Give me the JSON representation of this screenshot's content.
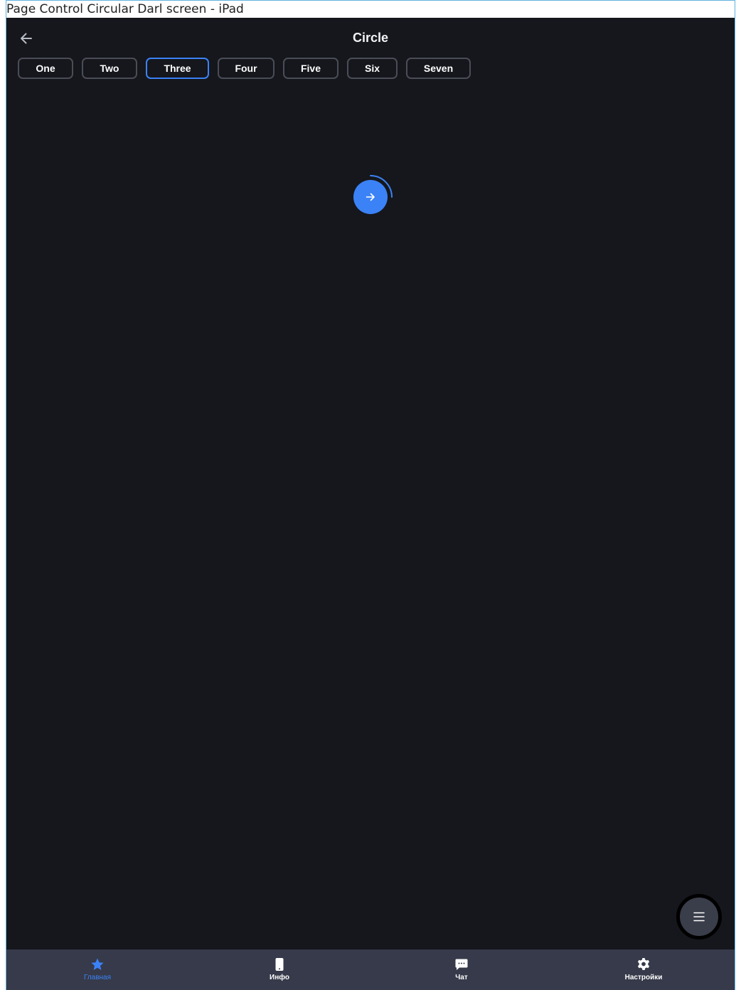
{
  "window": {
    "title": "Page Control Circular Darl screen - iPad"
  },
  "header": {
    "title": "Circle",
    "back_icon": "arrow-left-icon"
  },
  "segments": [
    {
      "label": "One",
      "selected": false
    },
    {
      "label": "Two",
      "selected": false
    },
    {
      "label": "Three",
      "selected": true
    },
    {
      "label": "Four",
      "selected": false
    },
    {
      "label": "Five",
      "selected": false
    },
    {
      "label": "Six",
      "selected": false
    },
    {
      "label": "Seven",
      "selected": false
    }
  ],
  "progress_button": {
    "icon": "arrow-right-icon",
    "progress": 0.25
  },
  "fab": {
    "icon": "menu-icon"
  },
  "tabbar": {
    "tabs": [
      {
        "label": "Главная",
        "icon": "star-icon",
        "active": true
      },
      {
        "label": "Инфо",
        "icon": "phone-icon",
        "active": false
      },
      {
        "label": "Чат",
        "icon": "chat-icon",
        "active": false
      },
      {
        "label": "Настройки",
        "icon": "gear-icon",
        "active": false
      }
    ]
  },
  "colors": {
    "accent": "#3b82f6",
    "background": "#15171c",
    "tabbar": "#363a4a",
    "segment_border": "#4a4d57"
  }
}
